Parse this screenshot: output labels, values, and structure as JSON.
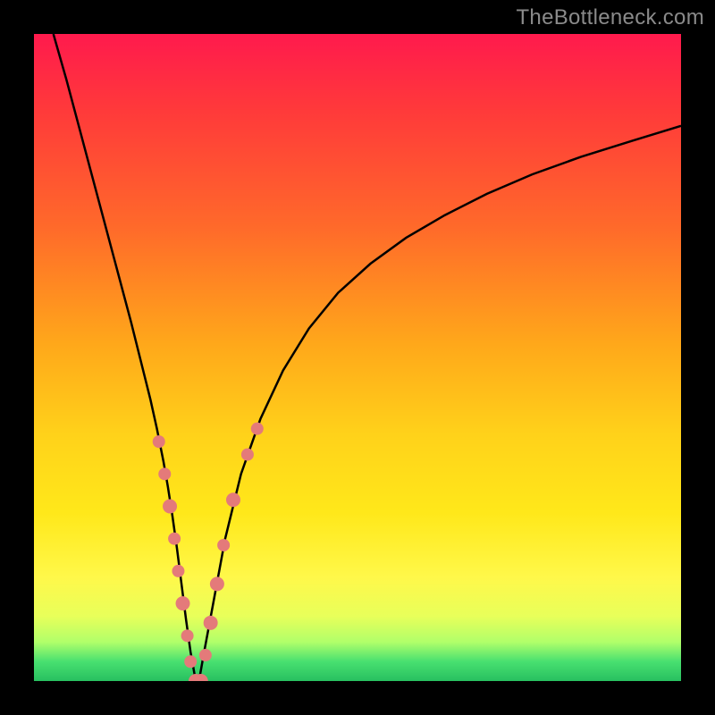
{
  "watermark": "TheBottleneck.com",
  "chart_data": {
    "type": "line",
    "title": "",
    "xlabel": "",
    "ylabel": "",
    "xlim": [
      0,
      100
    ],
    "ylim": [
      0,
      100
    ],
    "series": [
      {
        "name": "curve",
        "x": [
          3,
          5,
          7,
          9,
          11,
          13,
          15,
          17,
          18,
          19,
          20,
          20.7,
          21.4,
          22.1,
          22.8,
          23.5,
          24.2,
          25,
          25.5,
          26.3,
          27.7,
          29.55,
          32,
          35,
          38.5,
          42.5,
          47,
          52,
          57.5,
          63.5,
          70,
          77,
          84.5,
          92.5,
          100
        ],
        "y": [
          100,
          93,
          85.5,
          78,
          70.5,
          63,
          55.5,
          47.5,
          43.5,
          39,
          34,
          30,
          25.5,
          20.5,
          15,
          9.5,
          4.5,
          0,
          0,
          4.5,
          12,
          22,
          32,
          40.5,
          48,
          54.5,
          60,
          64.5,
          68.5,
          72,
          75.3,
          78.3,
          81,
          83.5,
          85.8
        ]
      }
    ],
    "markers": [
      {
        "x": 19.3,
        "y": 37,
        "r": 7
      },
      {
        "x": 20.2,
        "y": 32,
        "r": 7
      },
      {
        "x": 21.0,
        "y": 27,
        "r": 8
      },
      {
        "x": 21.7,
        "y": 22,
        "r": 7
      },
      {
        "x": 22.3,
        "y": 17,
        "r": 7
      },
      {
        "x": 23.0,
        "y": 12,
        "r": 8
      },
      {
        "x": 23.7,
        "y": 7,
        "r": 7
      },
      {
        "x": 24.2,
        "y": 3,
        "r": 7
      },
      {
        "x": 25.0,
        "y": 0,
        "r": 8
      },
      {
        "x": 25.8,
        "y": 0,
        "r": 8
      },
      {
        "x": 26.5,
        "y": 4,
        "r": 7
      },
      {
        "x": 27.3,
        "y": 9,
        "r": 8
      },
      {
        "x": 28.3,
        "y": 15,
        "r": 8
      },
      {
        "x": 29.3,
        "y": 21,
        "r": 7
      },
      {
        "x": 30.8,
        "y": 28,
        "r": 8
      },
      {
        "x": 33.0,
        "y": 35,
        "r": 7
      },
      {
        "x": 34.5,
        "y": 39,
        "r": 7
      }
    ],
    "gradient_stops": [
      {
        "pos": 0,
        "color": "#ff1a4d"
      },
      {
        "pos": 12,
        "color": "#ff3a3a"
      },
      {
        "pos": 30,
        "color": "#ff6a2a"
      },
      {
        "pos": 48,
        "color": "#ffa81a"
      },
      {
        "pos": 62,
        "color": "#ffd21a"
      },
      {
        "pos": 74,
        "color": "#ffe81a"
      },
      {
        "pos": 84,
        "color": "#fff84a"
      },
      {
        "pos": 90,
        "color": "#e8ff5a"
      },
      {
        "pos": 94,
        "color": "#b0ff6a"
      },
      {
        "pos": 97,
        "color": "#48e070"
      },
      {
        "pos": 100,
        "color": "#28c060"
      }
    ],
    "marker_color": "#e47a7a",
    "curve_color": "#000000"
  }
}
